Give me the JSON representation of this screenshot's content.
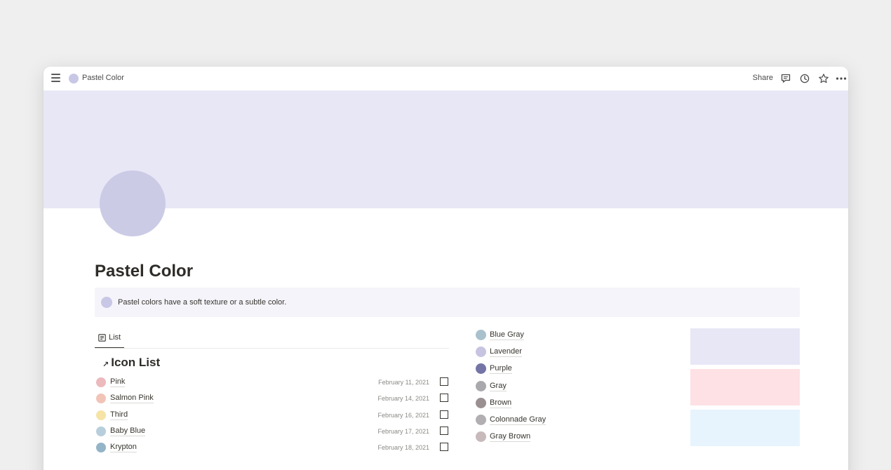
{
  "topbar": {
    "breadcrumb": "Pastel Color",
    "share_label": "Share",
    "icons": [
      "menu-icon",
      "comment-icon",
      "history-icon",
      "star-icon",
      "more-icon"
    ]
  },
  "page": {
    "title": "Pastel Color",
    "cover_color": "#e8e7f6",
    "icon_color": "#cccbe6"
  },
  "callout": {
    "text": "Pastel colors have a soft texture or a subtle color."
  },
  "view": {
    "tab_label": "List",
    "list_title": "Icon List"
  },
  "list": [
    {
      "name": "Pink",
      "date": "February 11, 2021",
      "color": "#ecb9bd"
    },
    {
      "name": "Salmon Pink",
      "date": "February 14, 2021",
      "color": "#f2c4b7"
    },
    {
      "name": "Third",
      "date": "February 16, 2021",
      "color": "#f6e3a6"
    },
    {
      "name": "Baby Blue",
      "date": "February 17, 2021",
      "color": "#b7cfdd"
    },
    {
      "name": "Krypton",
      "date": "February 18, 2021",
      "color": "#94b4c8"
    }
  ],
  "colors": [
    {
      "name": "Blue Gray",
      "color": "#a9c1cd"
    },
    {
      "name": "Lavender",
      "color": "#c6c4e1"
    },
    {
      "name": "Purple",
      "color": "#7475a6"
    },
    {
      "name": "Gray",
      "color": "#a9a8ac"
    },
    {
      "name": "Brown",
      "color": "#9b9091"
    },
    {
      "name": "Colonnade Gray",
      "color": "#b1afb2"
    },
    {
      "name": "Gray Brown",
      "color": "#c8b9bb"
    }
  ],
  "swatches": [
    "#e8e7f6",
    "#fde1e5",
    "#e7f4fd"
  ]
}
